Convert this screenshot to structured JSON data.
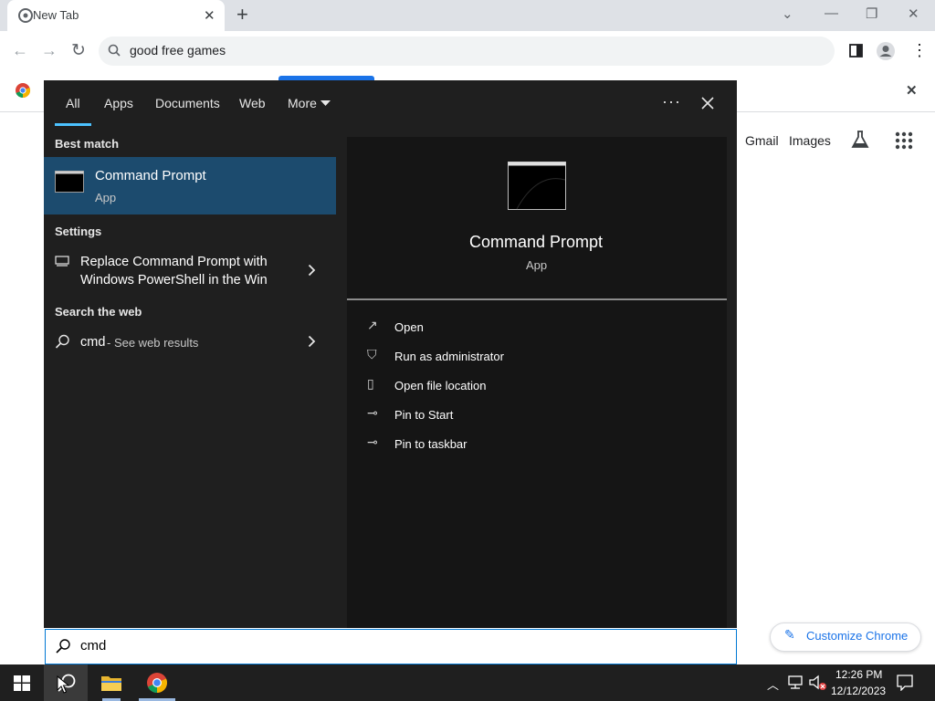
{
  "browser": {
    "tab_title": "New Tab",
    "omnibox_text": "good free games",
    "links": {
      "gmail": "Gmail",
      "images": "Images"
    },
    "customize_label": "Customize Chrome"
  },
  "start_panel": {
    "tabs": [
      "All",
      "Apps",
      "Documents",
      "Web",
      "More"
    ],
    "best_match": {
      "heading": "Best match",
      "title": "Command Prompt",
      "subtitle": "App"
    },
    "settings": {
      "heading": "Settings",
      "line1": "Replace Command Prompt with",
      "line2": "Windows PowerShell in the Win"
    },
    "web": {
      "heading": "Search the web",
      "query": "cmd",
      "suffix": " - See web results"
    },
    "preview": {
      "title": "Command Prompt",
      "subtitle": "App"
    },
    "actions": [
      "Open",
      "Run as administrator",
      "Open file location",
      "Pin to Start",
      "Pin to taskbar"
    ],
    "search_value": "cmd",
    "more_dots": "···"
  },
  "taskbar": {
    "time": "12:26 PM",
    "date": "12/12/2023"
  },
  "colors": {
    "accent": "#0078d4",
    "highlight": "#1c4b6e",
    "chrome_link": "#1a73e8"
  }
}
